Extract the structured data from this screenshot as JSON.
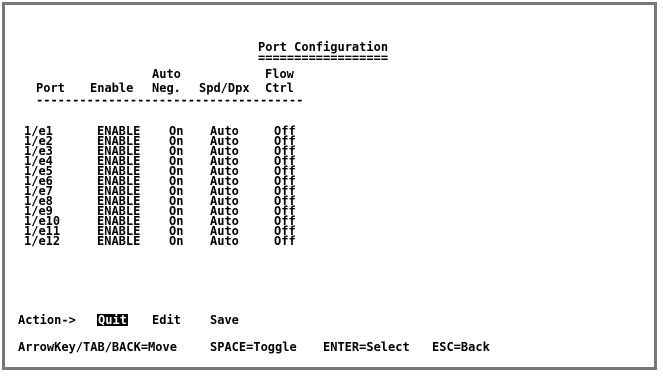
{
  "screen": {
    "title": "Port Configuration",
    "title_underline": "==================",
    "headers": {
      "port": "Port",
      "enable": "Enable",
      "auto_line1": "Auto",
      "auto_line2": "Neg.",
      "spd": "Spd/Dpx",
      "flow_line1": "Flow",
      "flow_line2": "Ctrl"
    },
    "separator": "-------------------------------------",
    "rows": [
      {
        "port": "1/e1",
        "enable": "ENABLE",
        "auto": "On",
        "spd": "Auto",
        "flow": "Off"
      },
      {
        "port": "1/e2",
        "enable": "ENABLE",
        "auto": "On",
        "spd": "Auto",
        "flow": "Off"
      },
      {
        "port": "1/e3",
        "enable": "ENABLE",
        "auto": "On",
        "spd": "Auto",
        "flow": "Off"
      },
      {
        "port": "1/e4",
        "enable": "ENABLE",
        "auto": "On",
        "spd": "Auto",
        "flow": "Off"
      },
      {
        "port": "1/e5",
        "enable": "ENABLE",
        "auto": "On",
        "spd": "Auto",
        "flow": "Off"
      },
      {
        "port": "1/e6",
        "enable": "ENABLE",
        "auto": "On",
        "spd": "Auto",
        "flow": "Off"
      },
      {
        "port": "1/e7",
        "enable": "ENABLE",
        "auto": "On",
        "spd": "Auto",
        "flow": "Off"
      },
      {
        "port": "1/e8",
        "enable": "ENABLE",
        "auto": "On",
        "spd": "Auto",
        "flow": "Off"
      },
      {
        "port": "1/e9",
        "enable": "ENABLE",
        "auto": "On",
        "spd": "Auto",
        "flow": "Off"
      },
      {
        "port": "1/e10",
        "enable": "ENABLE",
        "auto": "On",
        "spd": "Auto",
        "flow": "Off"
      },
      {
        "port": "1/e11",
        "enable": "ENABLE",
        "auto": "On",
        "spd": "Auto",
        "flow": "Off"
      },
      {
        "port": "1/e12",
        "enable": "ENABLE",
        "auto": "On",
        "spd": "Auto",
        "flow": "Off"
      }
    ],
    "action": {
      "label": "Action->",
      "quit": "Quit",
      "edit": "Edit",
      "save": "Save"
    },
    "help": {
      "move": "ArrowKey/TAB/BACK=Move",
      "toggle": "SPACE=Toggle",
      "select": "ENTER=Select",
      "back": "ESC=Back"
    }
  }
}
